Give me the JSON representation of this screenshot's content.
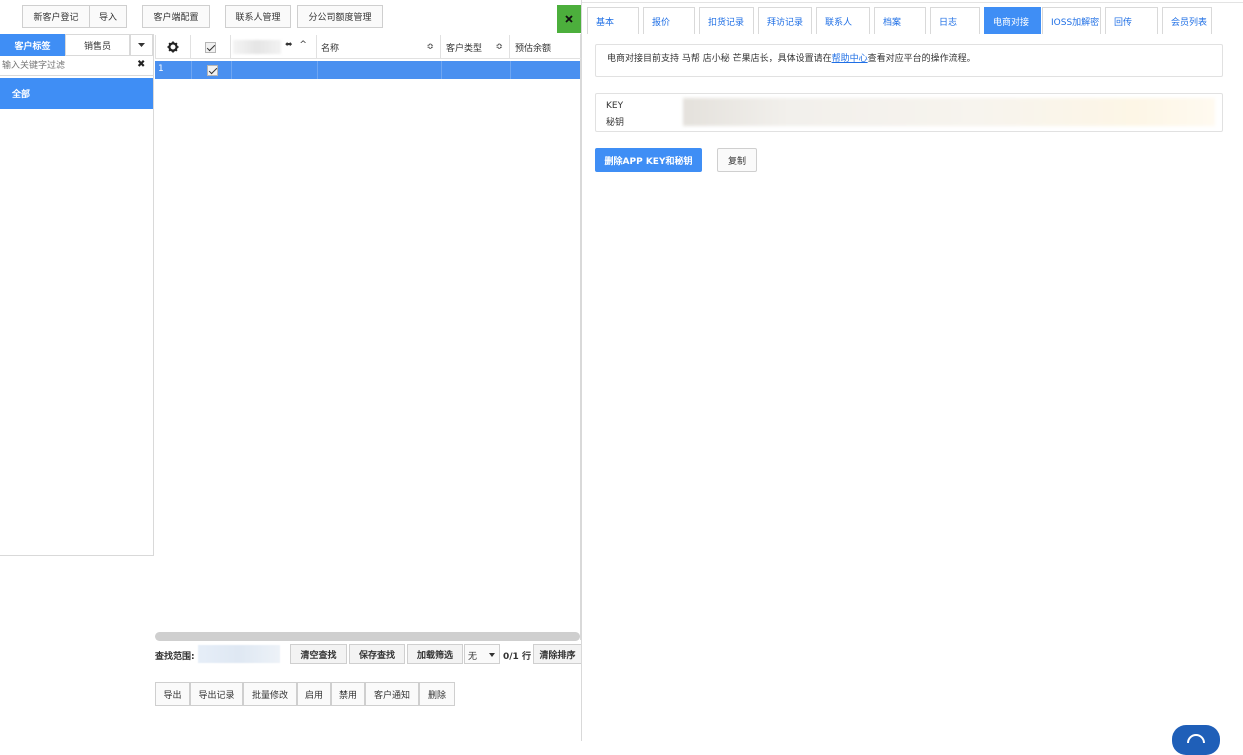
{
  "toolbar": {
    "new_customer": "新客户登记",
    "import": "导入",
    "client_config": "客户端配置",
    "contact_mgmt": "联系人管理",
    "branch_quota": "分公司额度管理"
  },
  "left_panel": {
    "tab_customer_tag": "客户标签",
    "tab_sales": "销售员",
    "filter_placeholder": "输入关键字过滤",
    "clear_glyph": "✖",
    "tree_all": "全部"
  },
  "grid": {
    "col_name": "名称",
    "col_customer_type": "客户类型",
    "col_balance": "预估余额",
    "row_number": "1",
    "sort_glyph": "⬍",
    "search_scope_label": "查找范围:",
    "clear_search": "清空查找",
    "save_search": "保存查找",
    "load_filter": "加载筛选",
    "filter_select_value": "无",
    "row_count": "0/1 行",
    "clear_sort": "清除排序"
  },
  "bottom_actions": [
    "导出",
    "导出记录",
    "批量修改",
    "启用",
    "禁用",
    "客户通知",
    "删除"
  ],
  "tabs": [
    "基本",
    "报价",
    "扣货记录",
    "拜访记录",
    "联系人",
    "档案",
    "日志",
    "电商对接",
    "IOSS加解密",
    "回传",
    "会员列表"
  ],
  "active_tab_index": 7,
  "ecommerce": {
    "info_prefix": "电商对接目前支持 马帮 店小秘 芒果店长，具体设置请在",
    "info_link": "帮助中心",
    "info_suffix": "查看对应平台的操作流程。",
    "key_label": "KEY",
    "secret_label": "秘钥",
    "delete_button": "删除APP KEY和秘钥",
    "copy_button": "复制"
  },
  "icons": {
    "close": "close-icon",
    "gear": "gear-icon",
    "dropdown": "caret-down-icon",
    "help": "help-chat-icon"
  },
  "colors": {
    "accent": "#3f8ef5",
    "selected_row": "#4a90f0",
    "close_button": "#4caf3c",
    "link": "#1f6fe5"
  }
}
